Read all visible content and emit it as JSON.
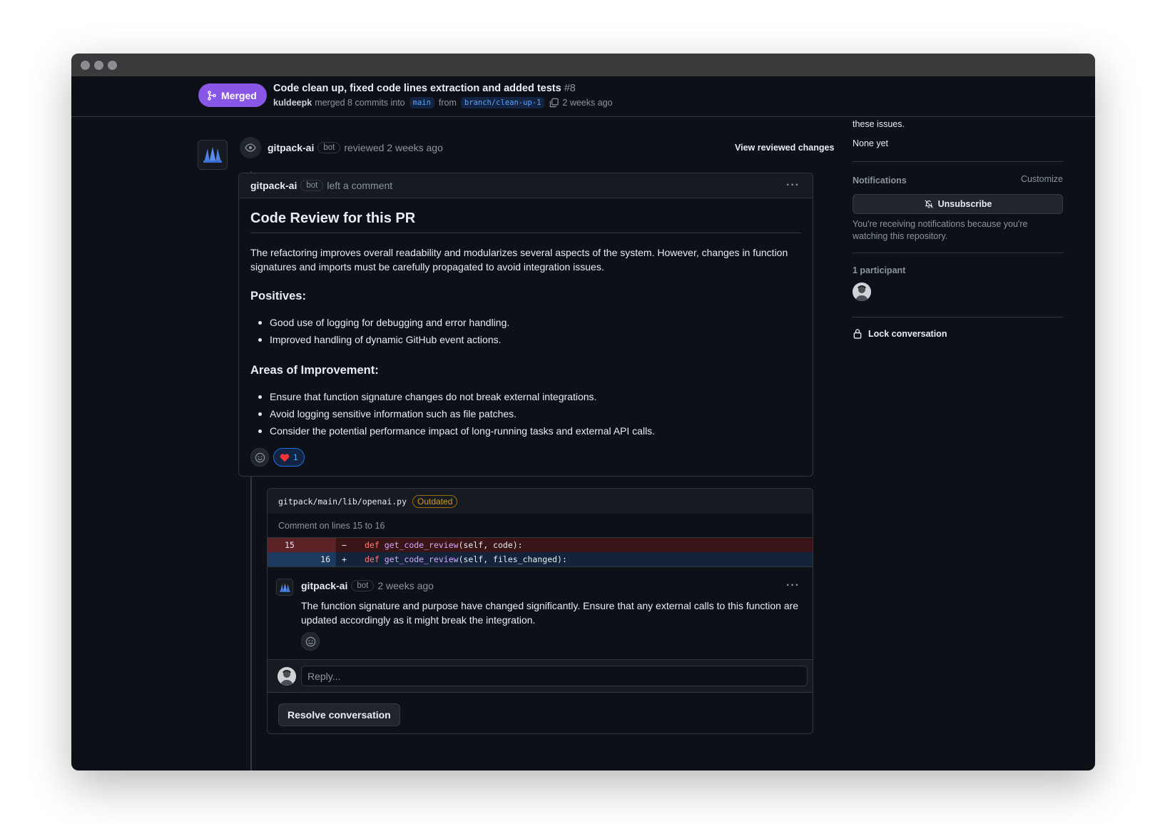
{
  "pr": {
    "status": "Merged",
    "title": "Code clean up, fixed code lines extraction and added tests",
    "number": "#8",
    "author": "kuldeepk",
    "merged_text": "merged 8 commits into",
    "base_branch": "main",
    "from_text": "from",
    "head_branch": "branch/clean-up-1",
    "time": "2 weeks ago"
  },
  "review": {
    "user": "gitpack-ai",
    "bot_label": "bot",
    "action": "reviewed 2 weeks ago",
    "view_changes": "View reviewed changes"
  },
  "comment": {
    "user": "gitpack-ai",
    "bot_label": "bot",
    "action": "left a comment",
    "heading": "Code Review for this PR",
    "intro": "The refactoring improves overall readability and modularizes several aspects of the system. However, changes in function signatures and imports must be carefully propagated to avoid integration issues.",
    "positives_heading": "Positives:",
    "positives": [
      "Good use of logging for debugging and error handling.",
      "Improved handling of dynamic GitHub event actions."
    ],
    "improvement_heading": "Areas of Improvement:",
    "improvements": [
      "Ensure that function signature changes do not break external integrations.",
      "Avoid logging sensitive information such as file patches.",
      "Consider the potential performance impact of long-running tasks and external API calls."
    ],
    "heart_count": "1"
  },
  "thread": {
    "file_path": "gitpack/main/lib/openai.py",
    "outdated_label": "Outdated",
    "lines_note": "Comment on lines 15 to 16",
    "diff": [
      {
        "old": "15",
        "new": "",
        "sign": "−",
        "kw": "def",
        "fn": "get_code_review",
        "rest": "(self, code):"
      },
      {
        "old": "",
        "new": "16",
        "sign": "+",
        "kw": "def",
        "fn": "get_code_review",
        "rest": "(self, files_changed):"
      }
    ],
    "reply_user": "gitpack-ai",
    "reply_bot_label": "bot",
    "reply_time": "2 weeks ago",
    "reply_text": "The function signature and purpose have changed significantly. Ensure that any external calls to this function are updated accordingly as it might break the integration.",
    "reply_placeholder": "Reply...",
    "resolve_label": "Resolve conversation"
  },
  "sidebar": {
    "clipped_text": "Successfully merging this pull request may close these issues.",
    "issues_value": "None yet",
    "notifications_title": "Notifications",
    "customize_label": "Customize",
    "unsubscribe_label": "Unsubscribe",
    "notifications_note": "You're receiving notifications because you're watching this repository.",
    "participants_title": "1 participant",
    "lock_label": "Lock conversation"
  },
  "colors": {
    "background": "#0d1117",
    "merged": "#8957e5",
    "accent": "#58a6ff",
    "outdated": "#d29922"
  }
}
